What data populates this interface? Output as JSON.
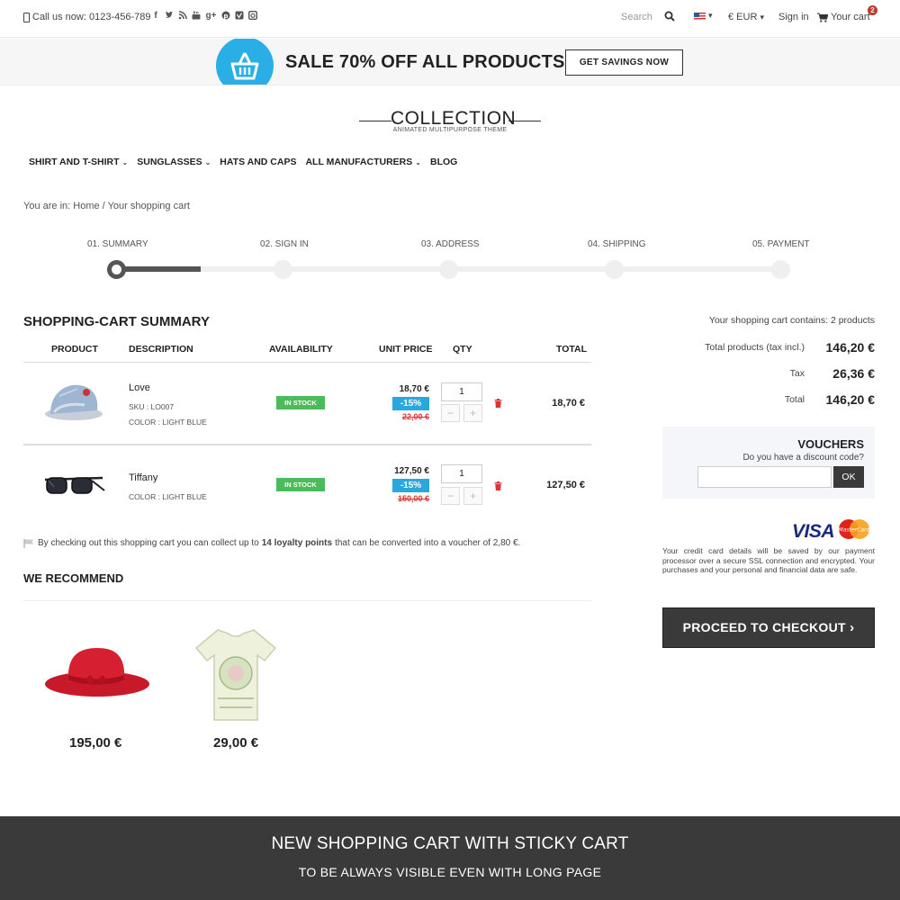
{
  "topbar": {
    "phone_text": "Call us now: 0123-456-789",
    "social_icons": [
      "facebook-icon",
      "twitter-icon",
      "rss-icon",
      "youtube-icon",
      "google-plus-icon",
      "pinterest-icon",
      "vimeo-icon",
      "instagram-icon"
    ],
    "search_placeholder": "Search",
    "currency": "€ EUR",
    "signin": "Sign in",
    "cart": "Your cart",
    "cart_count": "2"
  },
  "promo": {
    "text": "SALE 70% OFF ALL PRODUCTS",
    "button": "GET SAVINGS NOW"
  },
  "logo": {
    "title": "COLLECTION",
    "subtitle": "ANIMATED MULTIPURPOSE THEME"
  },
  "nav": [
    {
      "label": "SHIRT AND T-SHIRT",
      "dropdown": true
    },
    {
      "label": "SUNGLASSES",
      "dropdown": true
    },
    {
      "label": "HATS AND CAPS",
      "dropdown": false
    },
    {
      "label": "ALL MANUFACTURERS",
      "dropdown": true
    },
    {
      "label": "BLOG",
      "dropdown": false
    }
  ],
  "breadcrumb": {
    "prefix": "You are in:",
    "home": "Home",
    "current": "Your shopping cart"
  },
  "steps": [
    "01. SUMMARY",
    "02. SIGN IN",
    "03. ADDRESS",
    "04. SHIPPING",
    "05. PAYMENT"
  ],
  "cart": {
    "title": "SHOPPING-CART SUMMARY",
    "headers": [
      "PRODUCT",
      "DESCRIPTION",
      "AVAILABILITY",
      "UNIT PRICE",
      "QTY",
      "TOTAL"
    ],
    "items": [
      {
        "name": "Love",
        "sku": "SKU : LO007",
        "color": "COLOR : LIGHT BLUE",
        "availability": "IN STOCK",
        "price": "18,70 €",
        "discount": "-15%",
        "old_price": "22,00 €",
        "qty": "1",
        "total": "18,70 €"
      },
      {
        "name": "Tiffany",
        "sku": "",
        "color": "COLOR : LIGHT BLUE",
        "availability": "IN STOCK",
        "price": "127,50 €",
        "discount": "-15%",
        "old_price": "150,00 €",
        "qty": "1",
        "total": "127,50 €"
      }
    ],
    "loyalty_pre": "By checking out this shopping cart you can collect up to",
    "loyalty_points": "14 loyalty points",
    "loyalty_post": "that can be converted into a voucher of 2,80 €."
  },
  "recommend": {
    "title": "WE RECOMMEND",
    "items": [
      {
        "price": "195,00 €"
      },
      {
        "price": "29,00 €"
      }
    ]
  },
  "summary": {
    "contains": "Your shopping cart contains: 2 products",
    "rows": [
      {
        "label": "Total products (tax incl.)",
        "value": "146,20 €"
      },
      {
        "label": "Tax",
        "value": "26,36 €"
      },
      {
        "label": "Total",
        "value": "146,20 €"
      }
    ]
  },
  "vouchers": {
    "title": "VOUCHERS",
    "subtitle": "Do you have a discount code?",
    "ok": "OK"
  },
  "payment": {
    "visa": "VISA",
    "mastercard": "MasterCard",
    "note": "Your credit card details will be saved by our payment processor over a secure SSL connection and encrypted. Your purchases and your personal and financial data are safe."
  },
  "checkout": {
    "label": "PROCEED TO CHECKOUT"
  },
  "footer": {
    "title": "NEW SHOPPING CART WITH STICKY CART",
    "subtitle": "TO BE ALWAYS VISIBLE EVEN WITH LONG PAGE"
  },
  "colors": {
    "accent_blue": "#29aee6",
    "stock_green": "#4cbb5b",
    "discount_blue": "#29a8e0",
    "old_price_red": "#dd3333",
    "dark": "#3a3a3a"
  }
}
